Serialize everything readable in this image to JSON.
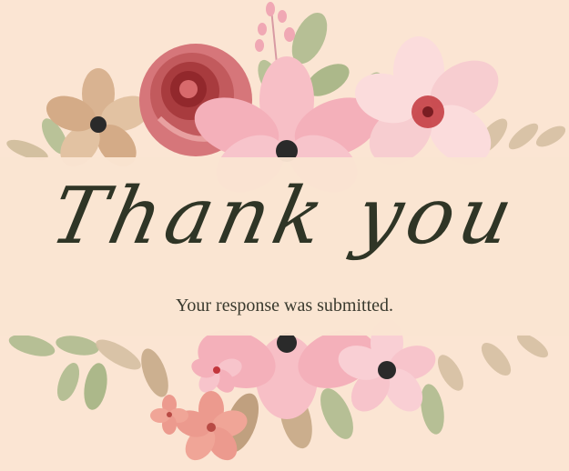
{
  "card": {
    "heading": "Thank you",
    "message": "Your response was submitted."
  },
  "colors": {
    "background": "#fbe5d3",
    "heading_text": "#2f3526",
    "message_text": "#3a3a2e",
    "rose_red": "#b94a48",
    "pink_petal": "#f6b4bd",
    "leaf_green": "#a9b98a",
    "tan_petal": "#d9b391"
  },
  "decorations": {
    "top": [
      "tan-flower-icon",
      "red-rose-icon",
      "pink-flower-icon",
      "light-pink-flower-icon",
      "leaf-icon",
      "buds-icon"
    ],
    "bottom": [
      "pink-flower-icon",
      "small-pink-flower-icon",
      "coral-flower-icon",
      "leaf-icon"
    ]
  }
}
